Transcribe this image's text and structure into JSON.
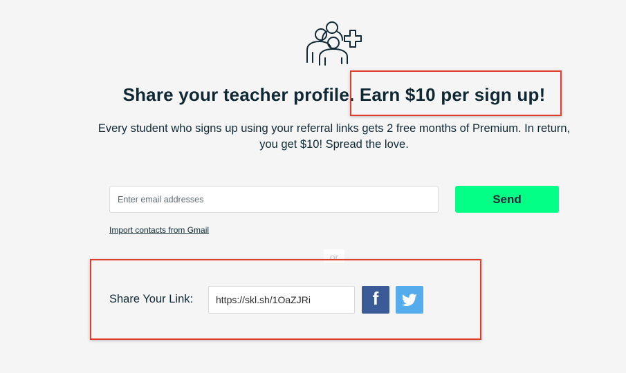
{
  "hero": {
    "icon": "add-people-icon"
  },
  "header": {
    "title": "Share your teacher profile. Earn $10 per sign up!",
    "subtitle": "Every student who signs up using your referral links gets 2 free months of Premium. In return, you get $10! Spread the love."
  },
  "invite": {
    "email_value": "",
    "email_placeholder": "Enter email addresses",
    "send_label": "Send",
    "gmail_link": "Import contacts from Gmail",
    "or_label": "or"
  },
  "share": {
    "label": "Share Your Link:",
    "link_value": "https://skl.sh/1OaZJRi",
    "facebook_icon": "facebook-icon",
    "twitter_icon": "twitter-icon"
  },
  "colors": {
    "accent": "#04ff86",
    "text": "#0f2834",
    "facebook": "#3b5a98",
    "twitter": "#55aced",
    "annotation": "#e23d2b"
  }
}
